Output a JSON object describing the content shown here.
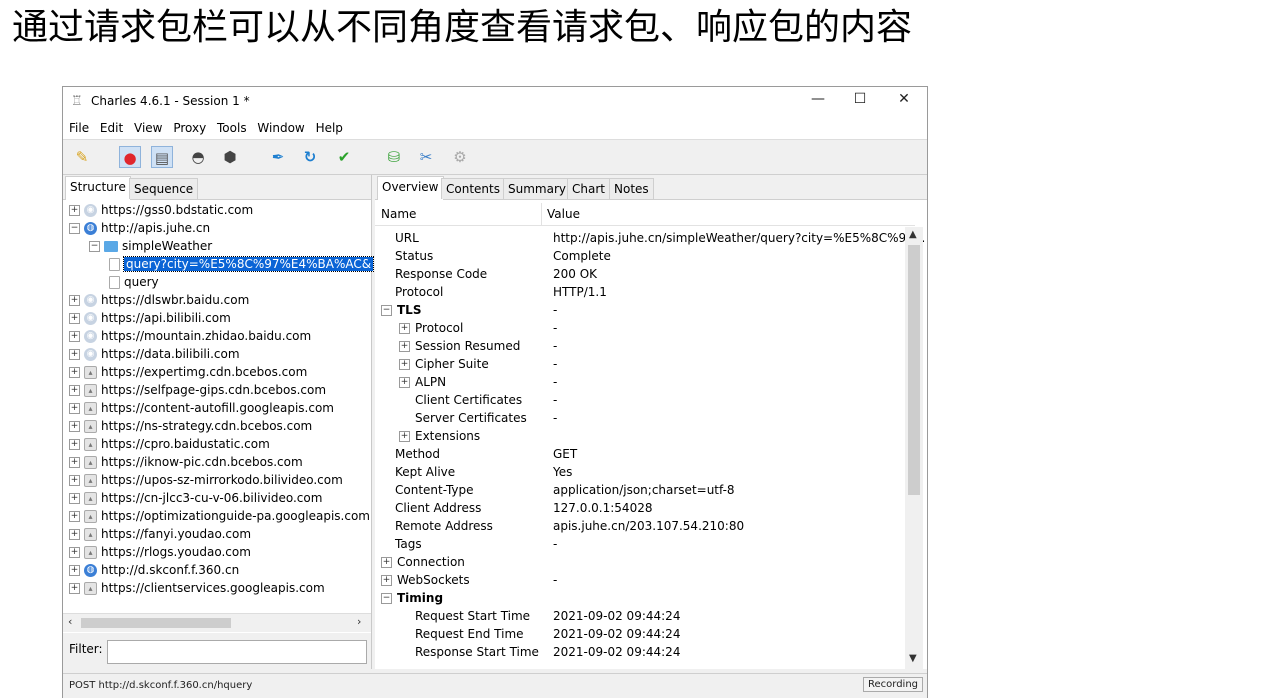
{
  "slide": {
    "heading": "通过请求包栏可以从不同角度查看请求包、响应包的内容"
  },
  "window": {
    "title": "Charles 4.6.1 - Session 1 *",
    "controls": {
      "minimize": "—",
      "maximize": "☐",
      "close": "✕"
    }
  },
  "menu": [
    "File",
    "Edit",
    "View",
    "Proxy",
    "Tools",
    "Window",
    "Help"
  ],
  "toolbar": {
    "icons": [
      "broom-icon",
      "record-icon",
      "throttle-icon",
      "turtle-icon",
      "stop-hexagon-icon",
      "pen-icon",
      "refresh-icon",
      "check-icon",
      "basket-icon",
      "tools-icon",
      "settings-gear-icon"
    ]
  },
  "left_tabs": [
    "Structure",
    "Sequence"
  ],
  "tree": [
    {
      "label": "https://gss0.bdstatic.com",
      "icon": "globe",
      "expander": "+",
      "indent": 0
    },
    {
      "label": "http://apis.juhe.cn",
      "icon": "globe-blue",
      "expander": "−",
      "indent": 0
    },
    {
      "label": "simpleWeather",
      "icon": "folder",
      "expander": "−",
      "indent": 1
    },
    {
      "label": "query?city=%E5%8C%97%E4%BA%AC&",
      "icon": "page",
      "expander": "",
      "indent": 2,
      "selected": true
    },
    {
      "label": "query",
      "icon": "page",
      "expander": "",
      "indent": 2
    },
    {
      "label": "https://dlswbr.baidu.com",
      "icon": "globe",
      "expander": "+",
      "indent": 0
    },
    {
      "label": "https://api.bilibili.com",
      "icon": "globe",
      "expander": "+",
      "indent": 0
    },
    {
      "label": "https://mountain.zhidao.baidu.com",
      "icon": "globe",
      "expander": "+",
      "indent": 0
    },
    {
      "label": "https://data.bilibili.com",
      "icon": "globe",
      "expander": "+",
      "indent": 0
    },
    {
      "label": "https://expertimg.cdn.bcebos.com",
      "icon": "lock",
      "expander": "+",
      "indent": 0
    },
    {
      "label": "https://selfpage-gips.cdn.bcebos.com",
      "icon": "lock",
      "expander": "+",
      "indent": 0
    },
    {
      "label": "https://content-autofill.googleapis.com",
      "icon": "lock",
      "expander": "+",
      "indent": 0
    },
    {
      "label": "https://ns-strategy.cdn.bcebos.com",
      "icon": "lock",
      "expander": "+",
      "indent": 0
    },
    {
      "label": "https://cpro.baidustatic.com",
      "icon": "lock",
      "expander": "+",
      "indent": 0
    },
    {
      "label": "https://iknow-pic.cdn.bcebos.com",
      "icon": "lock",
      "expander": "+",
      "indent": 0
    },
    {
      "label": "https://upos-sz-mirrorkodo.bilivideo.com",
      "icon": "lock",
      "expander": "+",
      "indent": 0
    },
    {
      "label": "https://cn-jlcc3-cu-v-06.bilivideo.com",
      "icon": "lock",
      "expander": "+",
      "indent": 0
    },
    {
      "label": "https://optimizationguide-pa.googleapis.com",
      "icon": "lock",
      "expander": "+",
      "indent": 0
    },
    {
      "label": "https://fanyi.youdao.com",
      "icon": "lock",
      "expander": "+",
      "indent": 0
    },
    {
      "label": "https://rlogs.youdao.com",
      "icon": "lock",
      "expander": "+",
      "indent": 0
    },
    {
      "label": "http://d.skconf.f.360.cn",
      "icon": "globe-blue",
      "expander": "+",
      "indent": 0
    },
    {
      "label": "https://clientservices.googleapis.com",
      "icon": "lock",
      "expander": "+",
      "indent": 0
    }
  ],
  "filter": {
    "label": "Filter:",
    "value": ""
  },
  "right_tabs": [
    "Overview",
    "Contents",
    "Summary",
    "Chart",
    "Notes"
  ],
  "columns": {
    "name": "Name",
    "value": "Value"
  },
  "properties": [
    {
      "name": "URL",
      "value": "http://apis.juhe.cn/simpleWeather/query?city=%E5%8C%97...",
      "level": 1
    },
    {
      "name": "Status",
      "value": "Complete",
      "level": 1
    },
    {
      "name": "Response Code",
      "value": "200 OK",
      "level": 1
    },
    {
      "name": "Protocol",
      "value": "HTTP/1.1",
      "level": 1
    },
    {
      "name": "TLS",
      "value": "-",
      "level": 0,
      "expander": "−",
      "bold": true
    },
    {
      "name": "Protocol",
      "value": "-",
      "level": 2,
      "expander": "+"
    },
    {
      "name": "Session Resumed",
      "value": "-",
      "level": 2,
      "expander": "+"
    },
    {
      "name": "Cipher Suite",
      "value": "-",
      "level": 2,
      "expander": "+"
    },
    {
      "name": "ALPN",
      "value": "-",
      "level": 2,
      "expander": "+"
    },
    {
      "name": "Client Certificates",
      "value": "-",
      "level": 2
    },
    {
      "name": "Server Certificates",
      "value": "-",
      "level": 2
    },
    {
      "name": "Extensions",
      "value": "",
      "level": 2,
      "expander": "+"
    },
    {
      "name": "Method",
      "value": "GET",
      "level": 1
    },
    {
      "name": "Kept Alive",
      "value": "Yes",
      "level": 1
    },
    {
      "name": "Content-Type",
      "value": "application/json;charset=utf-8",
      "level": 1
    },
    {
      "name": "Client Address",
      "value": "127.0.0.1:54028",
      "level": 1
    },
    {
      "name": "Remote Address",
      "value": "apis.juhe.cn/203.107.54.210:80",
      "level": 1
    },
    {
      "name": "Tags",
      "value": "-",
      "level": 1
    },
    {
      "name": "Connection",
      "value": "",
      "level": 0,
      "expander": "+"
    },
    {
      "name": "WebSockets",
      "value": "-",
      "level": 0,
      "expander": "+"
    },
    {
      "name": "Timing",
      "value": "",
      "level": 0,
      "expander": "−",
      "bold": true
    },
    {
      "name": "Request Start Time",
      "value": "2021-09-02 09:44:24",
      "level": 2
    },
    {
      "name": "Request End Time",
      "value": "2021-09-02 09:44:24",
      "level": 2
    },
    {
      "name": "Response Start Time",
      "value": "2021-09-02 09:44:24",
      "level": 2
    }
  ],
  "status_bar": {
    "text": "POST http://d.skconf.f.360.cn/hquery",
    "badge": "Recording"
  },
  "colors": {
    "selection": "#0a64d6",
    "record": "#e0262d",
    "check": "#2aa22a",
    "refresh": "#1e7fd0"
  }
}
